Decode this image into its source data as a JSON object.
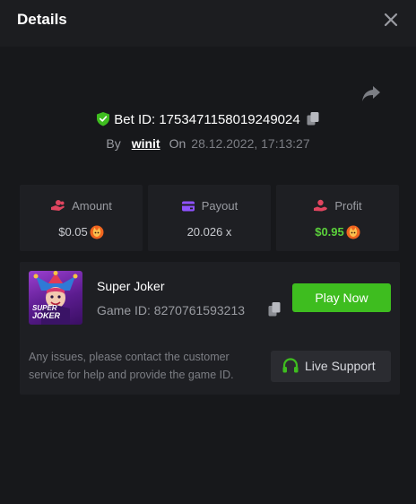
{
  "modal": {
    "title": "Details"
  },
  "bet": {
    "label": "Bet ID:",
    "id": "1753471158019249024",
    "by_label": "By",
    "user": "winit",
    "on_label": "On",
    "datetime": "28.12.2022, 17:13:27"
  },
  "stats": [
    {
      "label": "Amount",
      "value": "$0.05",
      "icon": "coins-hand-icon",
      "color": "#e0455f"
    },
    {
      "label": "Payout",
      "value": "20.026 x",
      "icon": "wallet-icon",
      "color": "#8f52ff"
    },
    {
      "label": "Profit",
      "value": "$0.95",
      "icon": "profit-hand-icon",
      "color": "#e0455f"
    }
  ],
  "game": {
    "name": "Super Joker",
    "id_label": "Game ID:",
    "id": "8270761593213",
    "thumb_text_1": "SUPER",
    "thumb_text_2": "JOKER",
    "play_label": "Play Now",
    "issue_text": "Any issues, please contact the customer service for help and provide the game ID.",
    "support_label": "Live Support"
  },
  "colors": {
    "accent": "#3ebd1f",
    "profit": "#5bd13b",
    "bg": "#17181b",
    "panel": "#1e1f23"
  }
}
